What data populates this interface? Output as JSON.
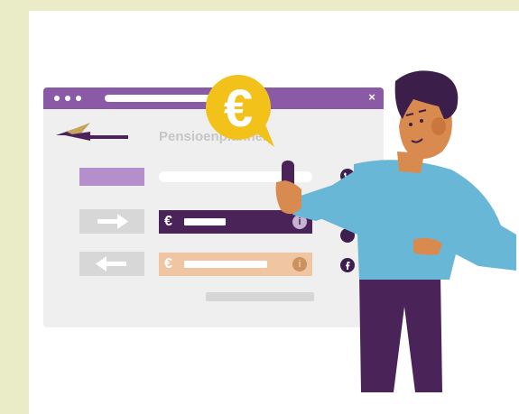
{
  "window": {
    "title": "Pensioenplanner",
    "close_label": "×"
  },
  "bubble": {
    "symbol": "€"
  },
  "rows": {
    "top_field_currency": "€",
    "bottom_field_currency": "€",
    "top_info_label": "i",
    "bottom_info_label": "i"
  },
  "side_icons": [
    "phone-icon",
    "mail-icon",
    "chat-icon",
    "facebook-icon"
  ],
  "colors": {
    "background": "#e9ecc7",
    "card": "#ffffff",
    "titlebar": "#8a5aa6",
    "dark_purple": "#4a2358",
    "light_purple": "#b48fcb",
    "orange_field": "#f0c6a2",
    "yellow": "#f2c21b",
    "shirt": "#69b7d6",
    "skin": "#d98a4e",
    "hair": "#3b1f4a"
  }
}
